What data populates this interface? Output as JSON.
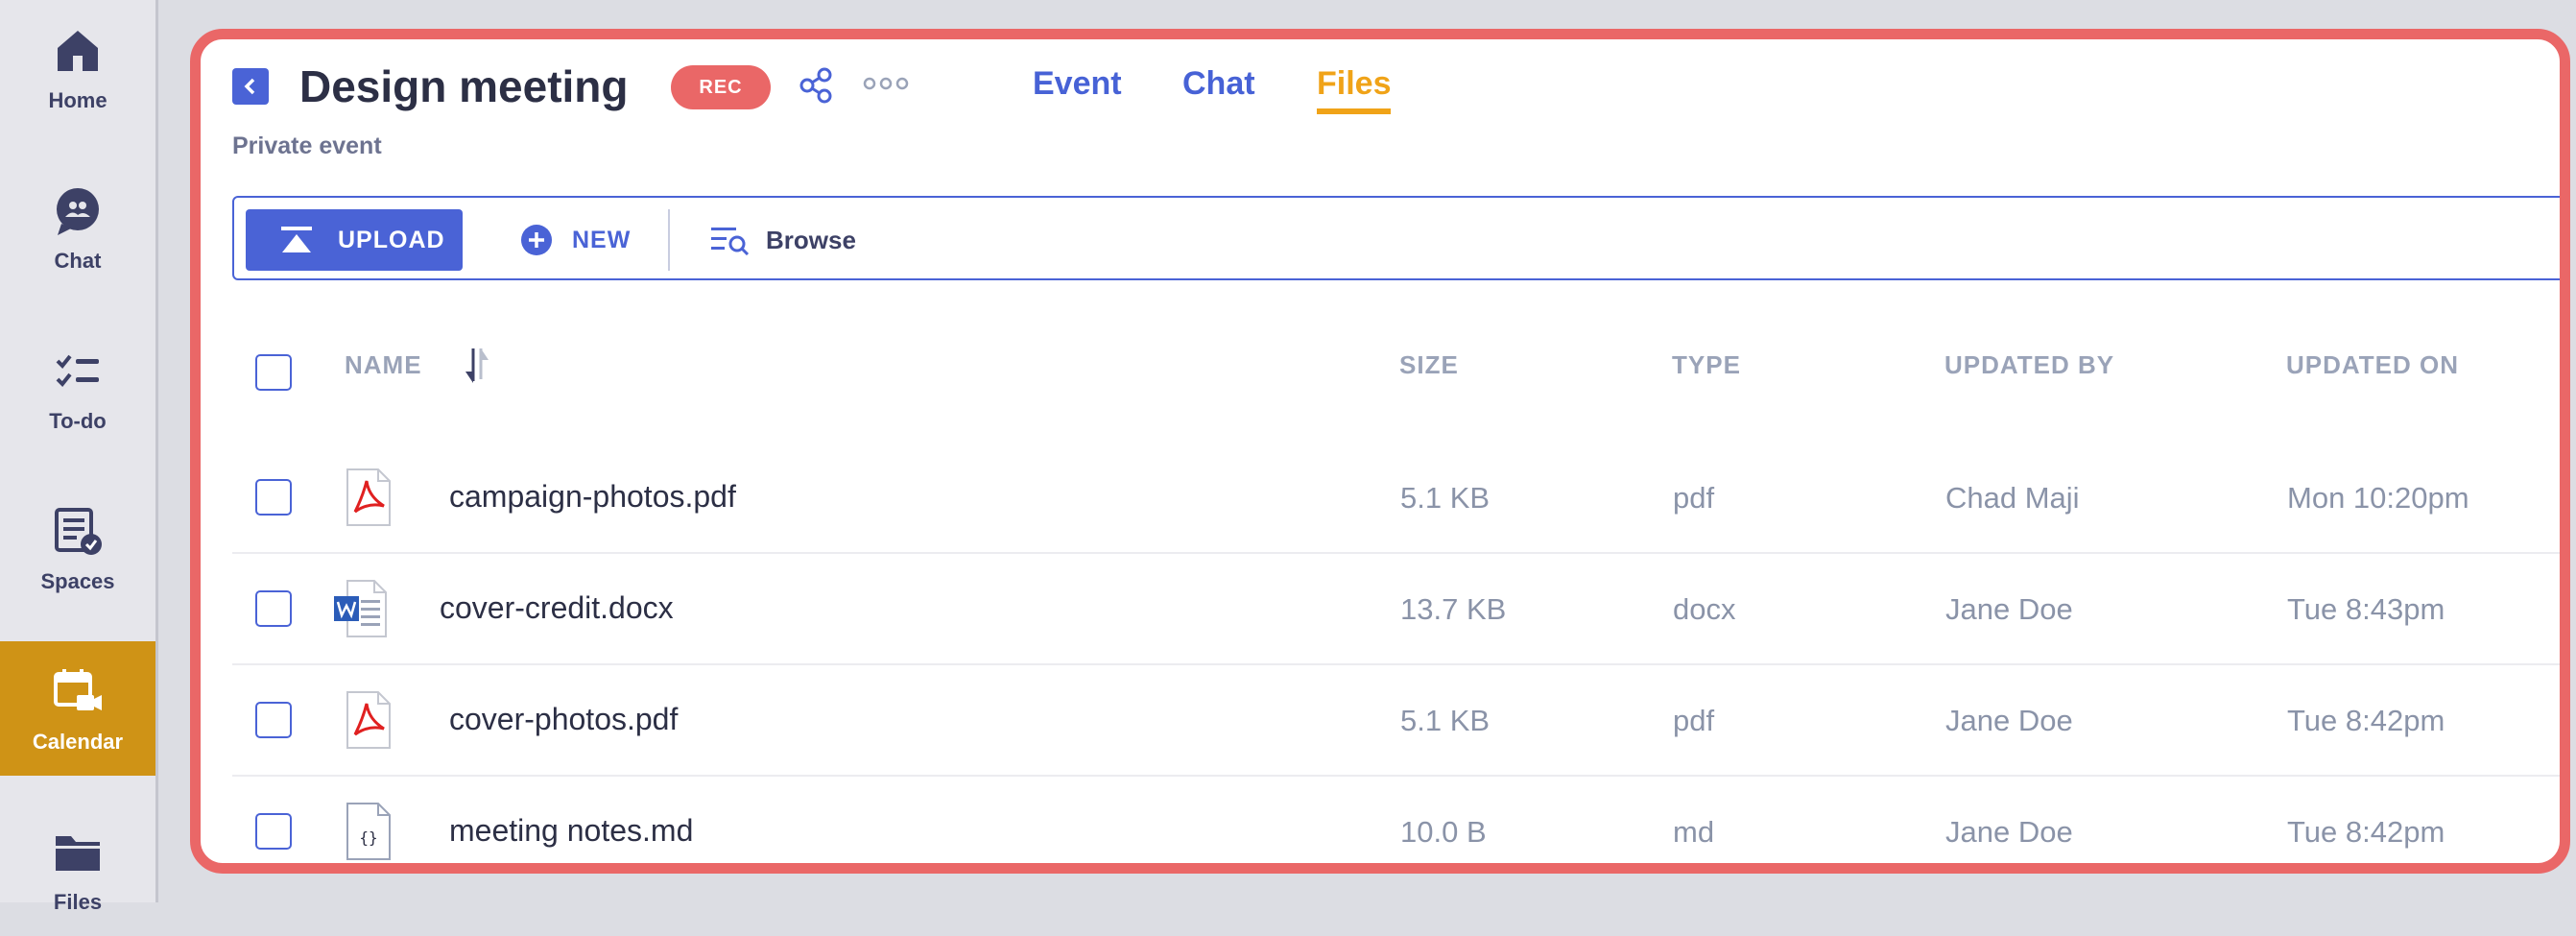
{
  "nav": {
    "items": [
      {
        "label": "Home",
        "icon": "home-icon"
      },
      {
        "label": "Chat",
        "icon": "chat-icon"
      },
      {
        "label": "To-do",
        "icon": "todo-icon"
      },
      {
        "label": "Spaces",
        "icon": "spaces-icon"
      },
      {
        "label": "Calendar",
        "icon": "calendar-icon",
        "active": true
      },
      {
        "label": "Files",
        "icon": "folder-icon"
      }
    ]
  },
  "header": {
    "title": "Design meeting",
    "rec_badge": "REC",
    "subtitle": "Private event",
    "tabs": [
      {
        "label": "Event"
      },
      {
        "label": "Chat"
      },
      {
        "label": "Files",
        "active": true
      }
    ]
  },
  "toolbar": {
    "upload_label": "UPLOAD",
    "new_label": "NEW",
    "browse_label": "Browse"
  },
  "table": {
    "columns": {
      "name": "NAME",
      "size": "SIZE",
      "type": "TYPE",
      "updated_by": "UPDATED BY",
      "updated_on": "UPDATED ON"
    },
    "rows": [
      {
        "name": "campaign-photos.pdf",
        "icon": "pdf-file-icon",
        "size": "5.1 KB",
        "type": "pdf",
        "updated_by": "Chad Maji",
        "updated_on": "Mon 10:20pm"
      },
      {
        "name": "cover-credit.docx",
        "icon": "word-file-icon",
        "size": "13.7 KB",
        "type": "docx",
        "updated_by": "Jane Doe",
        "updated_on": "Tue 8:43pm"
      },
      {
        "name": "cover-photos.pdf",
        "icon": "pdf-file-icon",
        "size": "5.1 KB",
        "type": "pdf",
        "updated_by": "Jane Doe",
        "updated_on": "Tue 8:42pm"
      },
      {
        "name": "meeting notes.md",
        "icon": "code-file-icon",
        "size": "10.0 B",
        "type": "md",
        "updated_by": "Jane Doe",
        "updated_on": "Tue 8:42pm"
      }
    ]
  },
  "colors": {
    "accent": "#4a63d6",
    "active_tab": "#f0a318",
    "nav_active": "#cf9316",
    "frame": "#ea6767"
  }
}
